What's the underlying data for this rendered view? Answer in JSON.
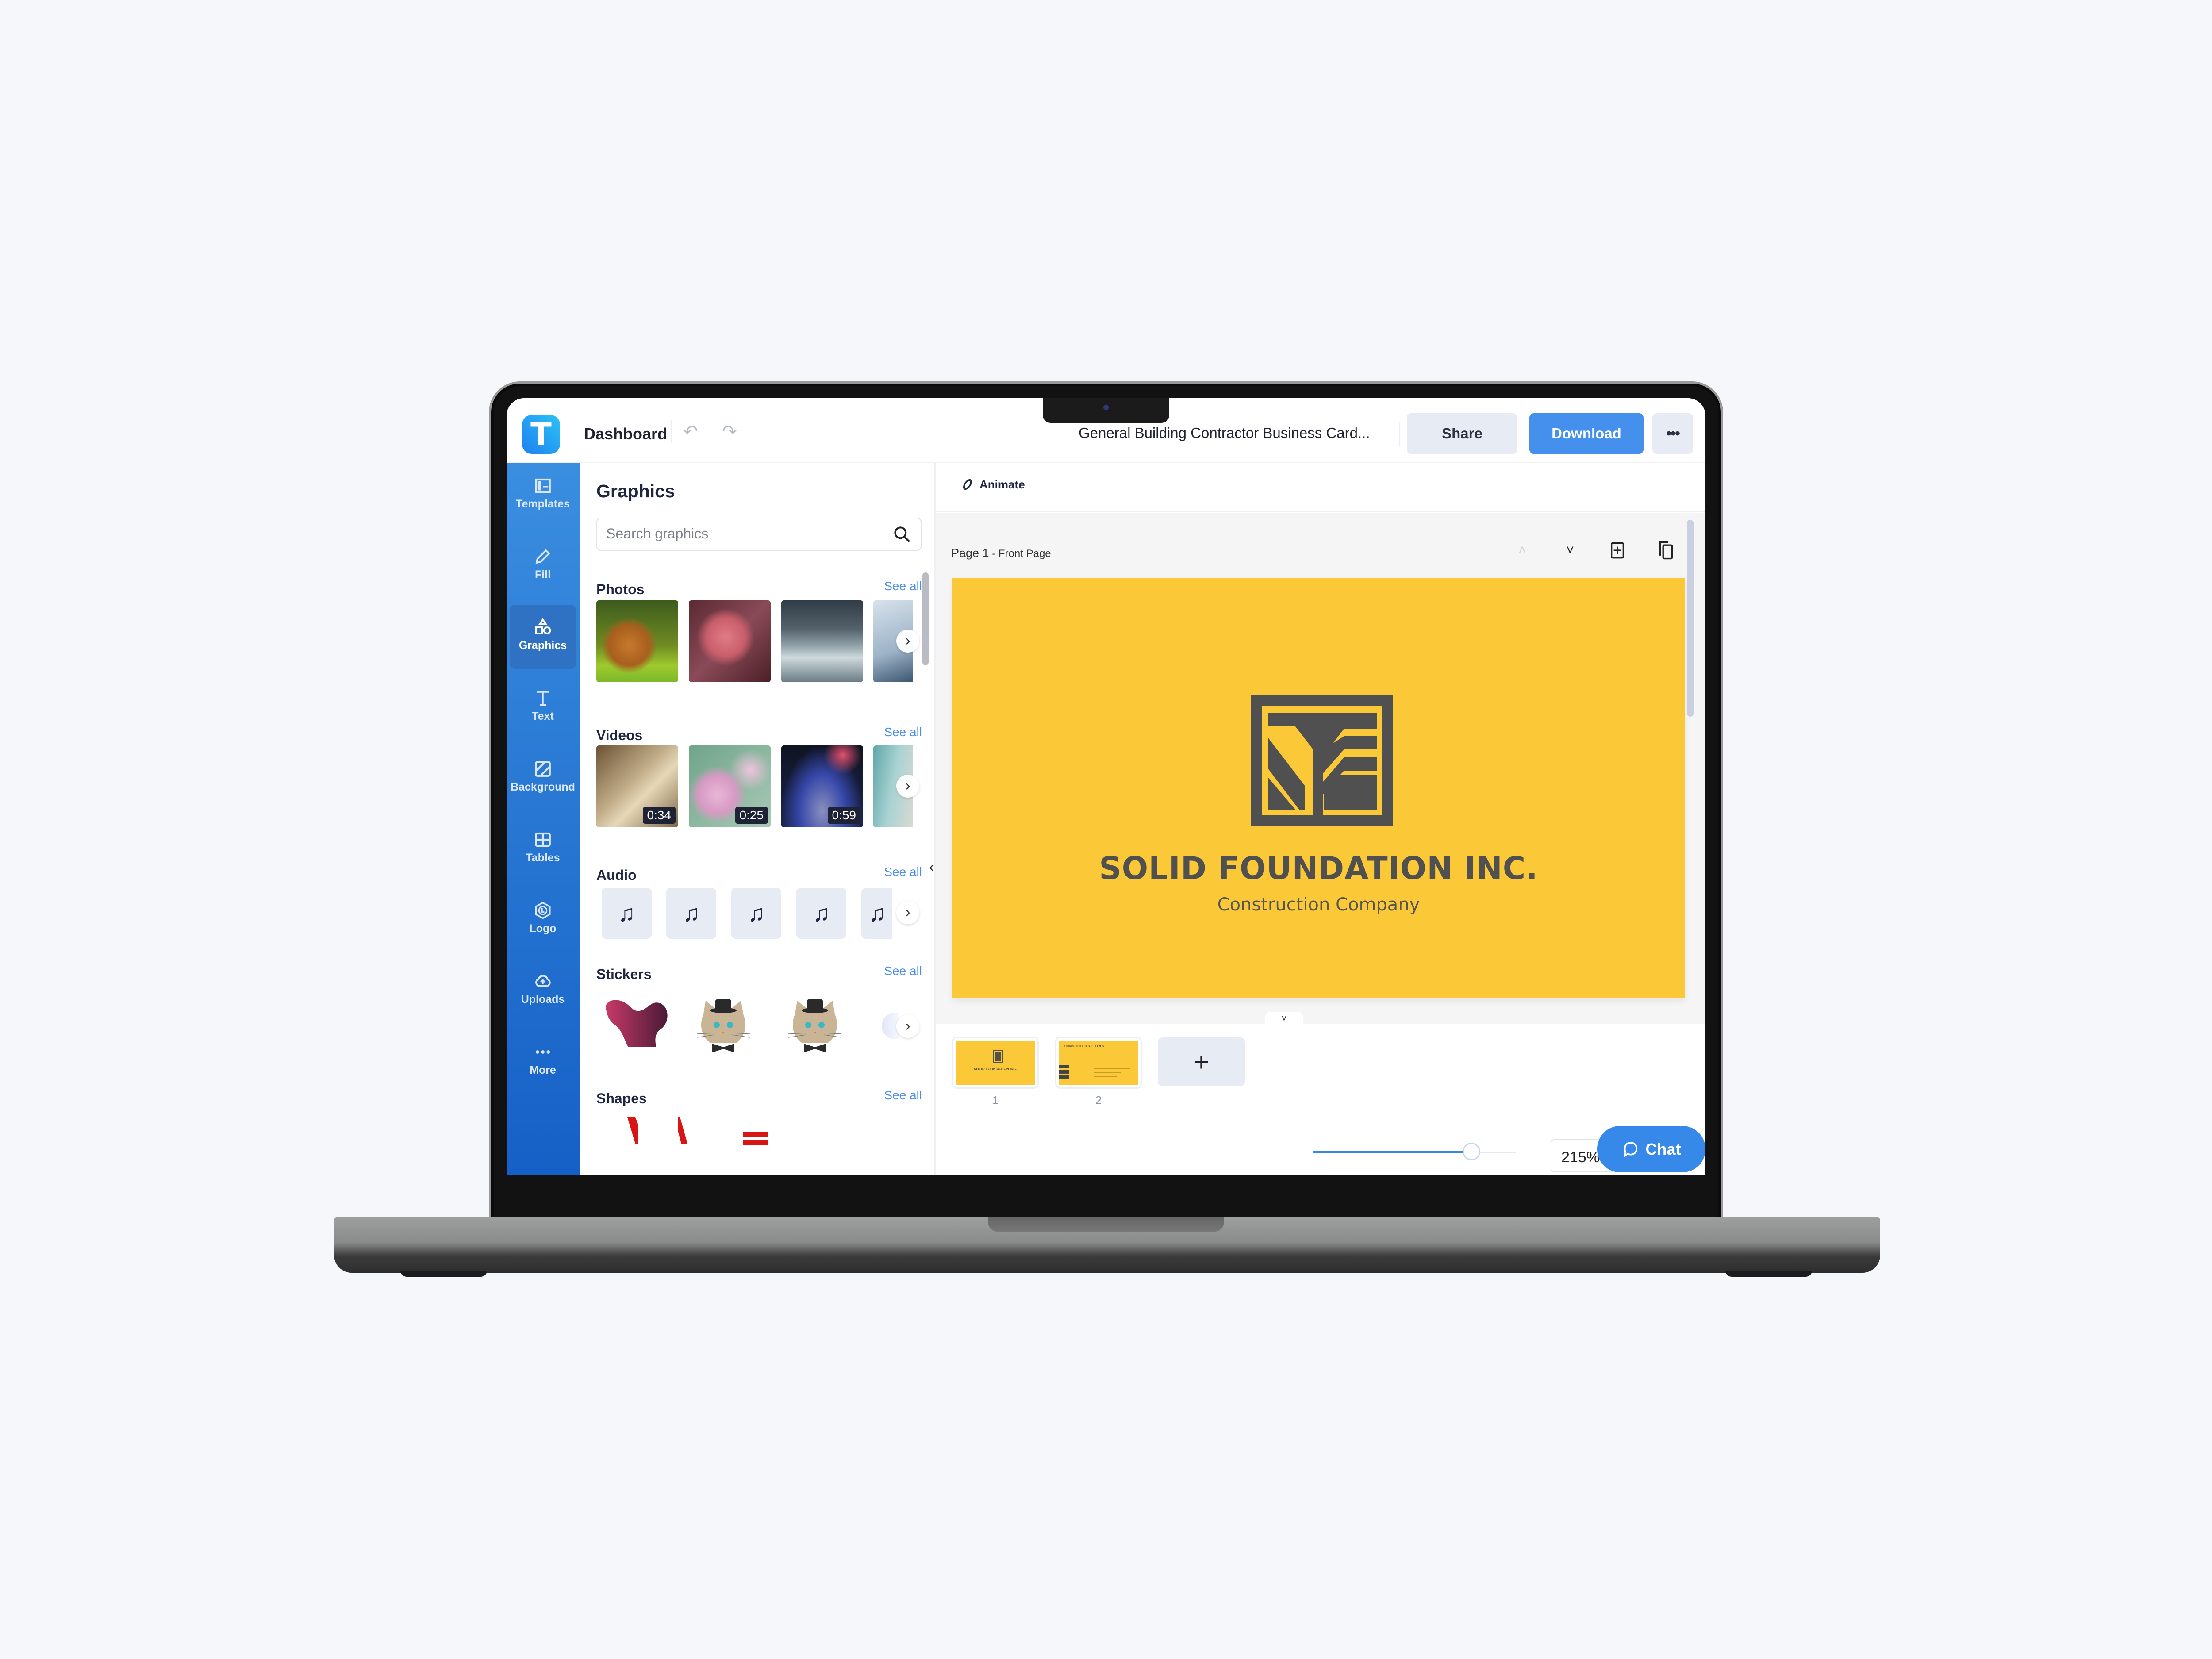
{
  "header": {
    "app_logo_letter": "T",
    "dashboard_label": "Dashboard",
    "undo_icon": "↶",
    "redo_icon": "↷",
    "document_title": "General Building Contractor Business Card...",
    "share_label": "Share",
    "download_label": "Download",
    "more_label": "•••"
  },
  "sidebar": {
    "items": [
      {
        "label": "Templates",
        "icon": "templates-icon",
        "active": false
      },
      {
        "label": "Fill",
        "icon": "pencil-icon",
        "active": false
      },
      {
        "label": "Graphics",
        "icon": "shapes-icon",
        "active": true
      },
      {
        "label": "Text",
        "icon": "text-icon",
        "active": false
      },
      {
        "label": "Background",
        "icon": "background-icon",
        "active": false
      },
      {
        "label": "Tables",
        "icon": "table-icon",
        "active": false
      },
      {
        "label": "Logo",
        "icon": "logo-icon",
        "active": false
      },
      {
        "label": "Uploads",
        "icon": "cloud-upload-icon",
        "active": false
      },
      {
        "label": "More",
        "icon": "more-icon",
        "active": false
      }
    ]
  },
  "panel": {
    "title": "Graphics",
    "search_placeholder": "Search graphics",
    "sections": {
      "photos": {
        "title": "Photos",
        "see_all": "See all",
        "items": [
          "squirrel",
          "pink leaves",
          "stormy sea",
          "seagulls"
        ]
      },
      "videos": {
        "title": "Videos",
        "see_all": "See all",
        "items": [
          {
            "subject": "misty forest",
            "duration": "0:34"
          },
          {
            "subject": "cherry blossoms",
            "duration": "0:25"
          },
          {
            "subject": "flower and smoke",
            "duration": "0:59"
          },
          {
            "subject": "ocean waves",
            "duration": ""
          }
        ]
      },
      "audio": {
        "title": "Audio",
        "see_all": "See all",
        "note_icon": "♫"
      },
      "stickers": {
        "title": "Stickers",
        "see_all": "See all",
        "items": [
          "gradient blob",
          "cat with top hat",
          "cat with top hat",
          "partial sticker"
        ]
      },
      "shapes": {
        "title": "Shapes",
        "see_all": "See all",
        "items": [
          "red slanted bar",
          "red slanted bar",
          "red equals"
        ]
      }
    }
  },
  "canvas": {
    "animate_label": "Animate",
    "page_label": "Page 1",
    "page_sublabel": " - Front Page",
    "card": {
      "company_name": "SOLID FOUNDATION INC.",
      "tagline": "Construction Company",
      "background_color": "#fbc838",
      "text_color": "#505050"
    },
    "pages": [
      {
        "number": "1",
        "caption": "SOLID FOUNDATION INC."
      },
      {
        "number": "2",
        "caption": "CHRISTOPHER S. FLORES"
      }
    ],
    "add_page_label": "+",
    "zoom_value": "215%",
    "zoom_fraction": 0.78,
    "chat_label": "Chat"
  },
  "colors": {
    "brand_blue": "#3a86e6",
    "sidebar_top": "#3a8ee0",
    "sidebar_bottom": "#1560c6",
    "card_yellow": "#fbc838",
    "card_gray": "#505050"
  }
}
